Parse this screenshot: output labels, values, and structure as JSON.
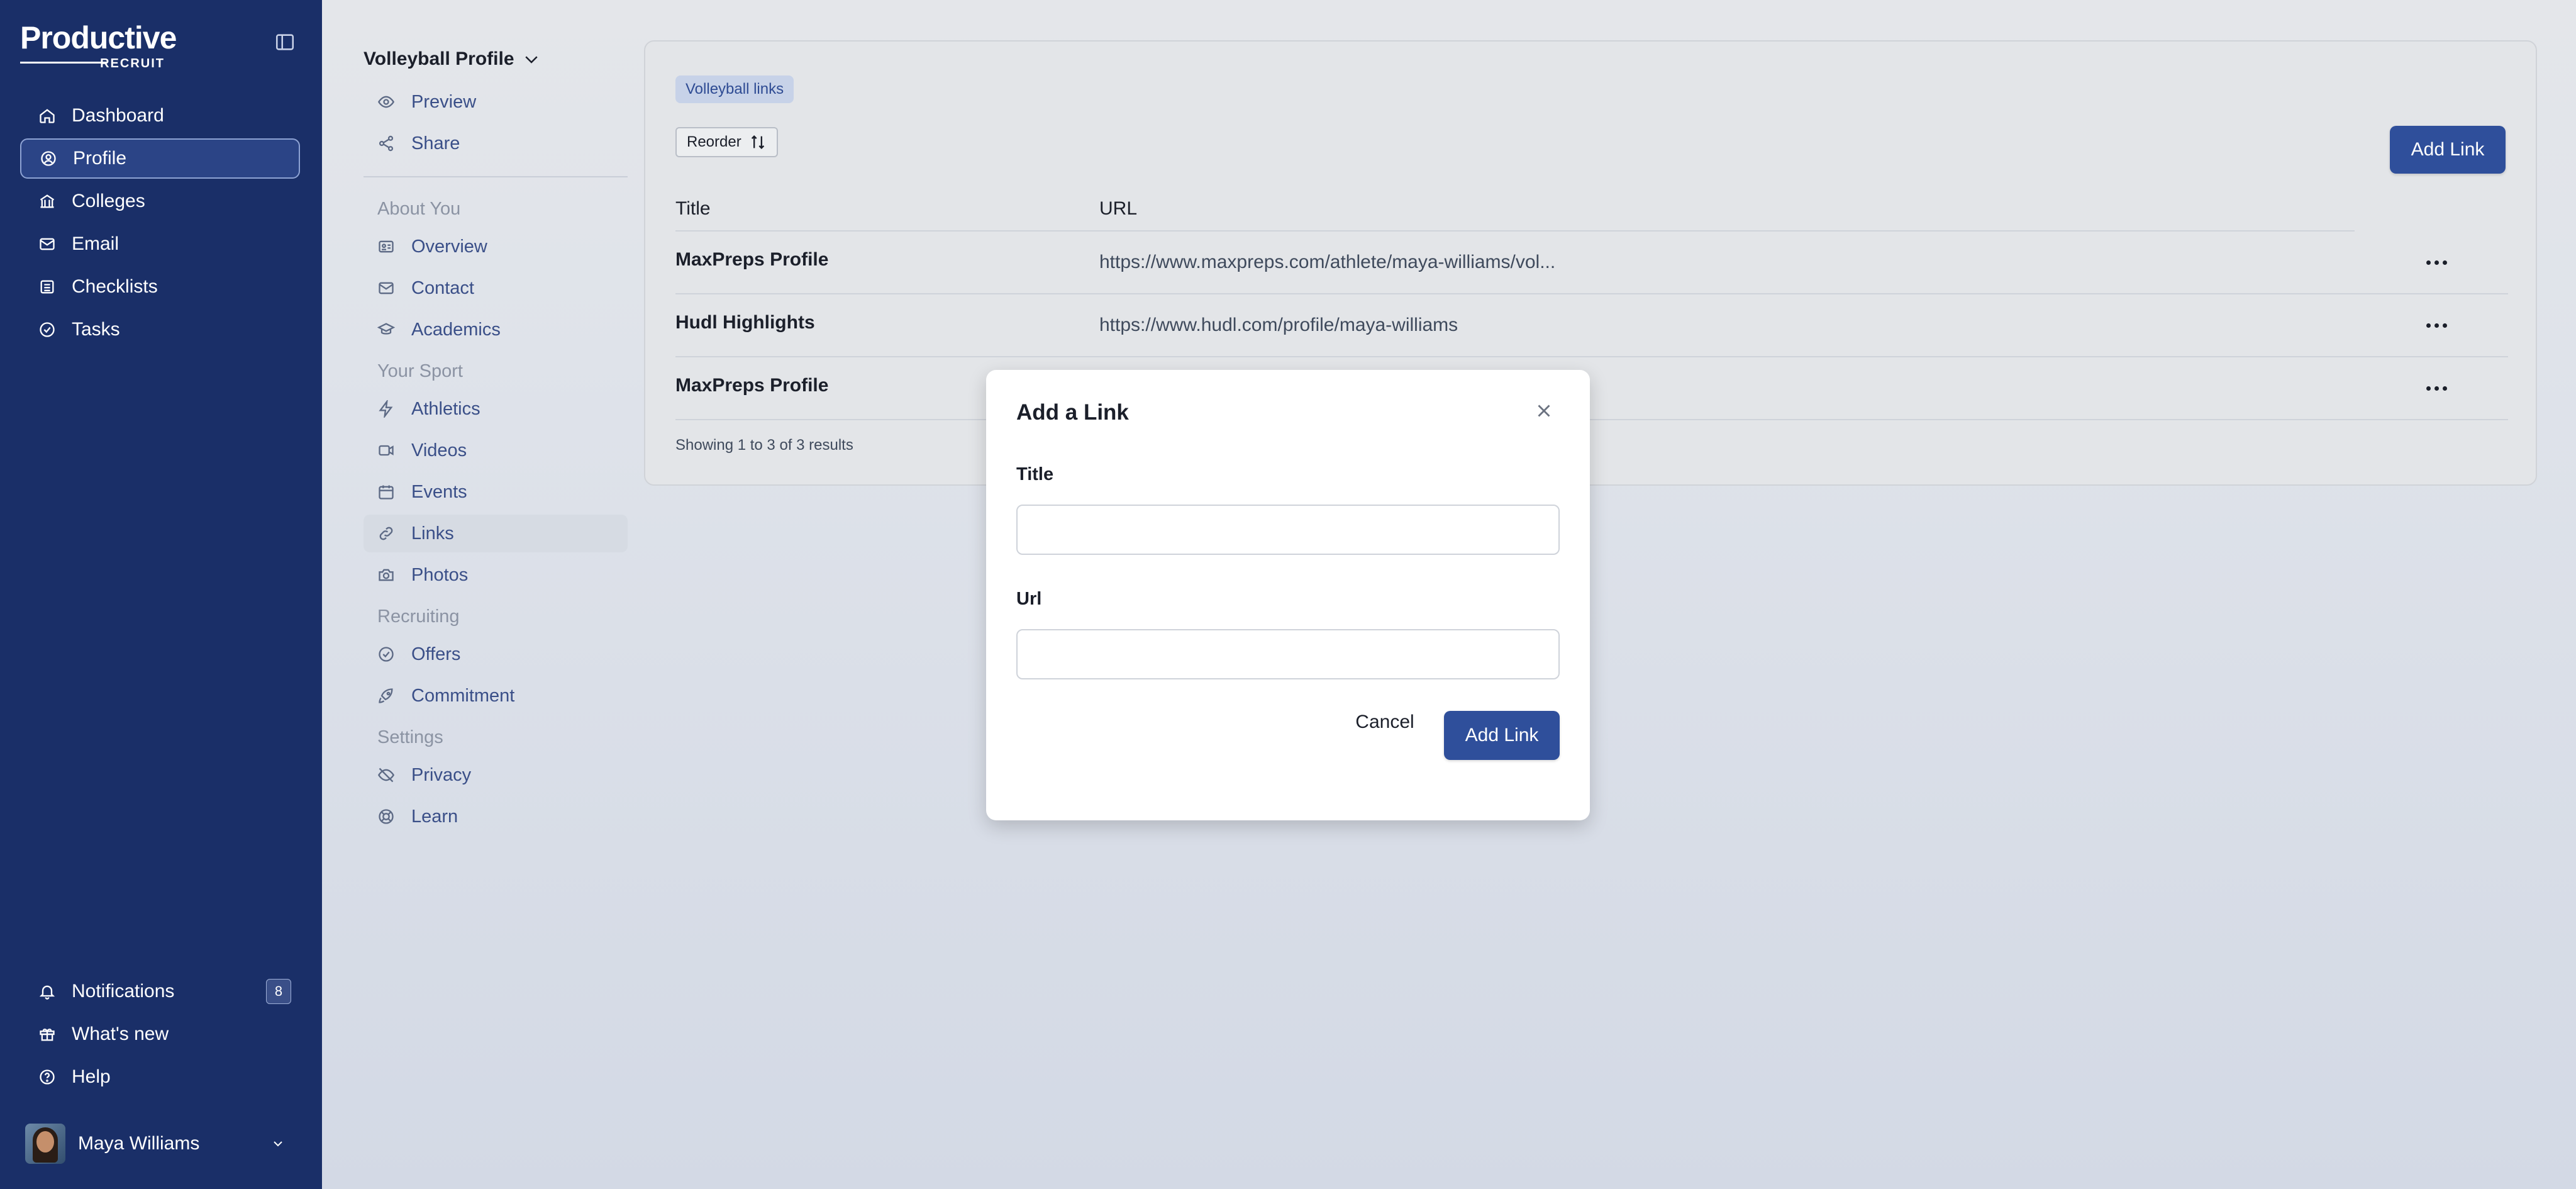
{
  "brand": {
    "name_main": "Productive",
    "name_sub": "RECRUIT"
  },
  "sidebar": {
    "items": [
      {
        "label": "Dashboard",
        "icon": "home-icon"
      },
      {
        "label": "Profile",
        "icon": "user-circle-icon"
      },
      {
        "label": "Colleges",
        "icon": "building-icon"
      },
      {
        "label": "Email",
        "icon": "mail-icon"
      },
      {
        "label": "Checklists",
        "icon": "list-icon"
      },
      {
        "label": "Tasks",
        "icon": "check-circle-icon"
      }
    ],
    "bottom": [
      {
        "label": "Notifications",
        "icon": "bell-icon",
        "badge": "8"
      },
      {
        "label": "What's new",
        "icon": "gift-icon"
      },
      {
        "label": "Help",
        "icon": "help-circle-icon"
      }
    ],
    "user": {
      "name": "Maya Williams"
    }
  },
  "subnav": {
    "title": "Volleyball Profile",
    "top_items": [
      {
        "label": "Preview",
        "icon": "eye-icon"
      },
      {
        "label": "Share",
        "icon": "share-icon"
      }
    ],
    "sections": [
      {
        "heading": "About You",
        "items": [
          {
            "label": "Overview",
            "icon": "id-card-icon"
          },
          {
            "label": "Contact",
            "icon": "mail-icon"
          },
          {
            "label": "Academics",
            "icon": "graduation-cap-icon"
          }
        ]
      },
      {
        "heading": "Your Sport",
        "items": [
          {
            "label": "Athletics",
            "icon": "bolt-icon"
          },
          {
            "label": "Videos",
            "icon": "video-icon"
          },
          {
            "label": "Events",
            "icon": "calendar-icon"
          },
          {
            "label": "Links",
            "icon": "link-icon"
          },
          {
            "label": "Photos",
            "icon": "camera-icon"
          }
        ]
      },
      {
        "heading": "Recruiting",
        "items": [
          {
            "label": "Offers",
            "icon": "check-circle-icon"
          },
          {
            "label": "Commitment",
            "icon": "rocket-icon"
          }
        ]
      },
      {
        "heading": "Settings",
        "items": [
          {
            "label": "Privacy",
            "icon": "eye-off-icon"
          },
          {
            "label": "Learn",
            "icon": "life-buoy-icon"
          }
        ]
      }
    ]
  },
  "main": {
    "chip": "Volleyball links",
    "reorder_label": "Reorder",
    "add_link_label": "Add Link",
    "columns": [
      "Title",
      "URL"
    ],
    "rows": [
      {
        "title": "MaxPreps Profile",
        "url": "https://www.maxpreps.com/athlete/maya-williams/vol..."
      },
      {
        "title": "Hudl Highlights",
        "url": "https://www.hudl.com/profile/maya-williams"
      },
      {
        "title": "MaxPreps Profile",
        "url": ""
      }
    ],
    "showing": "Showing 1 to 3 of 3 results"
  },
  "modal": {
    "title": "Add a Link",
    "title_label": "Title",
    "title_value": "",
    "url_label": "Url",
    "url_value": "",
    "cancel_label": "Cancel",
    "submit_label": "Add Link"
  }
}
